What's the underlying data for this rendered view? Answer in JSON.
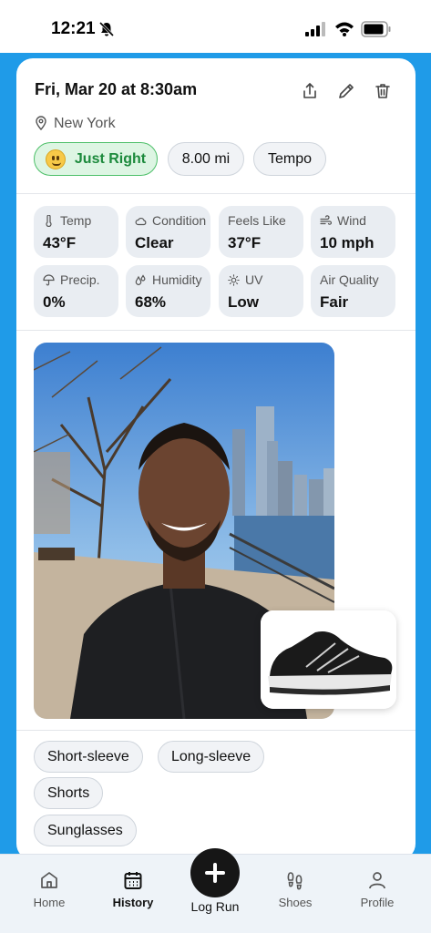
{
  "status_bar": {
    "time": "12:21"
  },
  "run": {
    "title": "Fri, Mar 20 at 8:30am",
    "location": "New York",
    "feel_label": "Just Right",
    "distance": "8.00 mi",
    "run_type": "Tempo"
  },
  "weather": [
    {
      "label": "Temp",
      "value": "43°F",
      "icon": "thermometer-icon"
    },
    {
      "label": "Condition",
      "value": "Clear",
      "icon": "cloud-icon"
    },
    {
      "label": "Feels Like",
      "value": "37°F",
      "icon": ""
    },
    {
      "label": "Wind",
      "value": "10 mph",
      "icon": "wind-icon"
    },
    {
      "label": "Precip.",
      "value": "0%",
      "icon": "umbrella-icon"
    },
    {
      "label": "Humidity",
      "value": "68%",
      "icon": "droplets-icon"
    },
    {
      "label": "UV",
      "value": "Low",
      "icon": "sun-icon"
    },
    {
      "label": "Air Quality",
      "value": "Fair",
      "icon": ""
    }
  ],
  "gear": [
    "Short-sleeve",
    "Long-sleeve",
    "Shorts",
    "Sunglasses"
  ],
  "tabs": [
    {
      "label": "Home",
      "icon": "home-icon"
    },
    {
      "label": "History",
      "icon": "calendar-icon"
    },
    {
      "label": "Log Run",
      "icon": "plus-icon"
    },
    {
      "label": "Shoes",
      "icon": "footprints-icon"
    },
    {
      "label": "Profile",
      "icon": "user-icon"
    }
  ],
  "colors": {
    "accent_blue": "#1f9be8",
    "feel_green": "#1c8a3c",
    "chip_bg": "#f1f3f6"
  }
}
